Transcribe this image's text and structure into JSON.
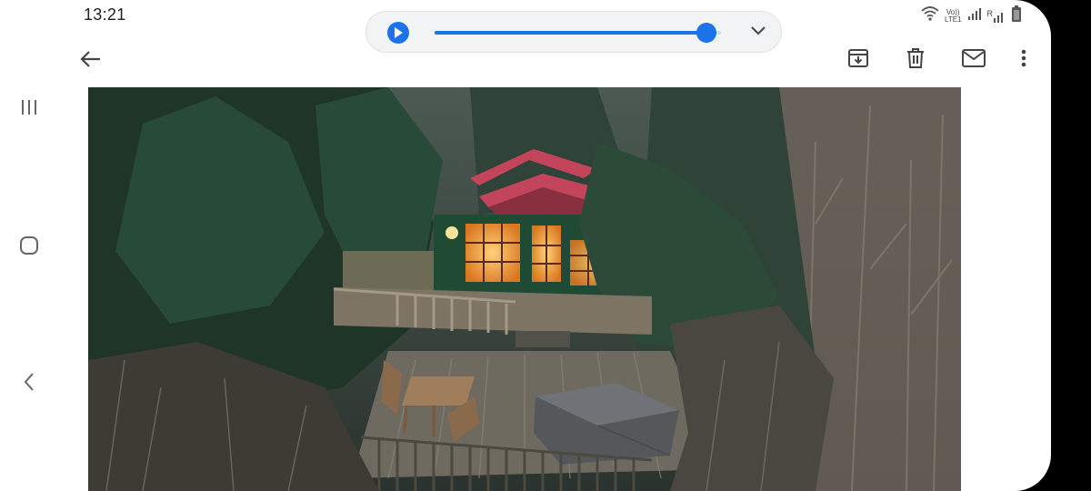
{
  "status_bar": {
    "time": "13:21",
    "icons": [
      "wifi-icon",
      "volte-icon",
      "signal-icon",
      "roaming-signal-icon",
      "battery-icon"
    ],
    "network_label_top": "Vo))",
    "network_label_bottom": "LTE1",
    "roaming_label": "R"
  },
  "audio_player": {
    "play_icon": "play-icon",
    "progress": 0.95,
    "expand_icon": "chevron-down-icon"
  },
  "toolbar": {
    "back_icon": "back-arrow-icon",
    "actions": [
      "archive-icon",
      "delete-icon",
      "mark-unread-icon",
      "more-options-icon"
    ]
  },
  "system_nav": [
    "recent-apps-icon",
    "home-icon",
    "back-icon"
  ],
  "attachment": {
    "type": "photo",
    "subject": "cabin in the woods"
  },
  "colors": {
    "accent": "#1a73e8",
    "roof": "#c2455c",
    "window_light": "#f0a24a"
  }
}
